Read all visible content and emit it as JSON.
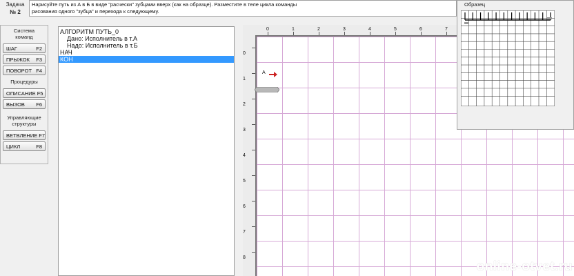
{
  "task": {
    "label_line1": "Задача",
    "label_line2": "№ 2",
    "text_line1": "Нарисуйте путь из А в Б в виде \"расчески\" зубцами вверх (как на образце). Разместите в теле цикла команды",
    "text_line2": "рисования одного \"зубца\" и перехода к следующему."
  },
  "sidebar": {
    "group1_line1": "Система",
    "group1_line2": "команд",
    "buttons1": [
      {
        "label": "ШАГ",
        "key": "F2"
      },
      {
        "label": "ПРЫЖОК",
        "key": "F3"
      },
      {
        "label": "ПОВОРОТ",
        "key": "F4"
      }
    ],
    "group2": "Процедуры",
    "buttons2": [
      {
        "label": "ОПИСАНИЕ",
        "key": "F5"
      },
      {
        "label": "ВЫЗОВ",
        "key": "F6"
      }
    ],
    "group3_line1": "Управляющие",
    "group3_line2": "структуры",
    "buttons3": [
      {
        "label": "ВЕТВЛЕНИЕ",
        "key": "F7"
      },
      {
        "label": "ЦИКЛ",
        "key": "F8"
      }
    ]
  },
  "editor": {
    "lines": [
      "АЛГОРИТМ ПУТЬ_0",
      "Дано: Исполнитель в т.А",
      "Надо: Исполнитель в т.Б",
      "НАЧ",
      "КОН"
    ]
  },
  "field": {
    "x_ticks": [
      "0",
      "1",
      "2",
      "3",
      "4",
      "5",
      "6",
      "7"
    ],
    "y_ticks": [
      "0",
      "1",
      "2",
      "3",
      "4",
      "5",
      "6",
      "7",
      "8"
    ],
    "agent_label": "А"
  },
  "sample": {
    "title": "Образец"
  },
  "watermark": "online-otvet.ru",
  "colors": {
    "selection": "#3399ff",
    "grid": "#d6a8d6",
    "arrow": "#cc2222"
  }
}
